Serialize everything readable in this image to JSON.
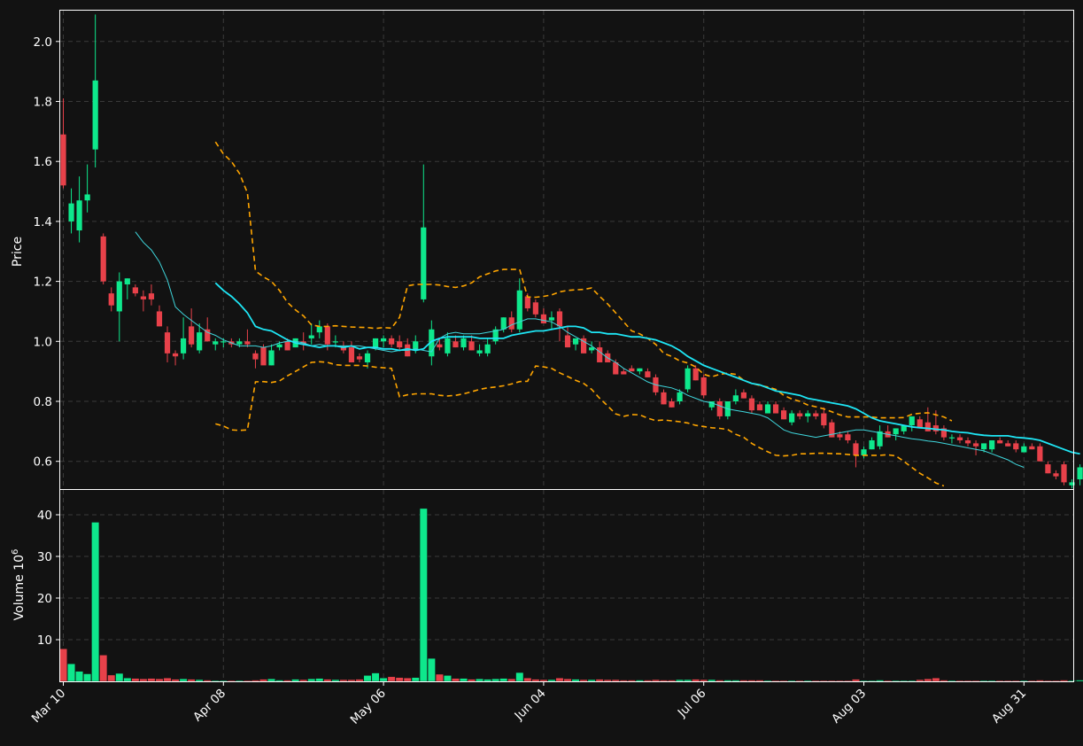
{
  "colors": {
    "background": "#121212",
    "up": "#0ee88c",
    "down": "#e8414a",
    "ma_fast": "#1ee6f5",
    "ma_slow": "#3fd6dc",
    "bands": "#ffa500",
    "grid": "#3a3a3a",
    "frame": "#ffffff"
  },
  "chart_data": {
    "type": "candlestick",
    "ylabel": "Price",
    "volume_label": "Volume  10",
    "volume_exponent": "6",
    "price_ticks": [
      "0.6",
      "0.8",
      "1.0",
      "1.2",
      "1.4",
      "1.6",
      "1.8",
      "2.0"
    ],
    "volume_ticks": [
      "10",
      "20",
      "30",
      "40"
    ],
    "x_tick_labels": [
      "Mar 10",
      "Apr 08",
      "May 06",
      "Jun 04",
      "Jul 06",
      "Aug 03",
      "Aug 31"
    ],
    "x_tick_index": [
      0,
      20,
      40,
      60,
      80,
      100,
      120
    ],
    "ylim": [
      0.5,
      2.1
    ],
    "volume_ylim": [
      0,
      46
    ],
    "grid": true,
    "candles": [
      [
        1.69,
        1.81,
        1.51,
        1.52,
        7.8
      ],
      [
        1.4,
        1.51,
        1.36,
        1.46,
        4.2
      ],
      [
        1.37,
        1.55,
        1.33,
        1.47,
        2.4
      ],
      [
        1.47,
        1.59,
        1.43,
        1.49,
        1.8
      ],
      [
        1.64,
        2.09,
        1.58,
        1.87,
        38.2
      ],
      [
        1.35,
        1.36,
        1.19,
        1.2,
        6.3
      ],
      [
        1.16,
        1.18,
        1.1,
        1.12,
        1.5
      ],
      [
        1.1,
        1.23,
        1,
        1.2,
        1.9
      ],
      [
        1.19,
        1.21,
        1.14,
        1.21,
        0.8
      ],
      [
        1.18,
        1.19,
        1.15,
        1.16,
        0.7
      ],
      [
        1.15,
        1.17,
        1.1,
        1.14,
        0.6
      ],
      [
        1.16,
        1.19,
        1.12,
        1.14,
        0.7
      ],
      [
        1.1,
        1.12,
        1.05,
        1.05,
        0.6
      ],
      [
        1.03,
        1.05,
        0.93,
        0.96,
        0.8
      ],
      [
        0.96,
        0.97,
        0.92,
        0.95,
        0.5
      ],
      [
        0.96,
        1.08,
        0.94,
        1.01,
        0.6
      ],
      [
        1.05,
        1.11,
        0.98,
        0.99,
        0.5
      ],
      [
        0.97,
        1.06,
        0.96,
        1.03,
        0.4
      ],
      [
        1.04,
        1.08,
        1,
        1,
        0.3
      ],
      [
        0.99,
        1.01,
        0.97,
        1,
        0.2
      ],
      [
        1,
        1.01,
        0.98,
        1,
        0.2
      ],
      [
        1,
        1.01,
        0.98,
        0.99,
        0.2
      ],
      [
        0.99,
        1.01,
        0.98,
        1,
        0.2
      ],
      [
        1,
        1.04,
        0.98,
        0.99,
        0.2
      ],
      [
        0.96,
        0.97,
        0.91,
        0.94,
        0.3
      ],
      [
        0.98,
        0.99,
        0.93,
        0.92,
        0.5
      ],
      [
        0.92,
        0.99,
        0.92,
        0.97,
        0.6
      ],
      [
        0.98,
        1,
        0.97,
        0.99,
        0.3
      ],
      [
        1,
        1.01,
        0.97,
        0.97,
        0.3
      ],
      [
        0.98,
        1.01,
        0.98,
        1.01,
        0.5
      ],
      [
        1,
        1.03,
        0.97,
        0.99,
        0.4
      ],
      [
        1.01,
        1.06,
        0.99,
        1.02,
        0.6
      ],
      [
        1.03,
        1.07,
        1.01,
        1.05,
        0.7
      ],
      [
        1.05,
        1.06,
        0.97,
        0.99,
        0.5
      ],
      [
        1,
        1.02,
        0.98,
        1,
        0.4
      ],
      [
        0.98,
        1,
        0.96,
        0.97,
        0.4
      ],
      [
        0.98,
        1,
        0.93,
        0.93,
        0.4
      ],
      [
        0.95,
        0.96,
        0.93,
        0.94,
        0.5
      ],
      [
        0.93,
        0.97,
        0.91,
        0.96,
        1.4
      ],
      [
        0.98,
        1.01,
        0.97,
        1.01,
        2
      ],
      [
        1,
        1.02,
        0.98,
        1.01,
        0.8
      ],
      [
        1.01,
        1.02,
        0.98,
        0.99,
        1.1
      ],
      [
        1,
        1.02,
        0.97,
        0.98,
        0.9
      ],
      [
        0.99,
        1.01,
        0.95,
        0.95,
        0.8
      ],
      [
        0.97,
        1.02,
        0.96,
        1,
        0.9
      ],
      [
        1.14,
        1.59,
        1.13,
        1.38,
        41.5
      ],
      [
        0.95,
        1.07,
        0.92,
        1.04,
        5.5
      ],
      [
        0.99,
        1.01,
        0.97,
        0.98,
        1.7
      ],
      [
        0.96,
        1.03,
        0.95,
        1.01,
        1.4
      ],
      [
        1,
        1.02,
        0.98,
        0.98,
        0.7
      ],
      [
        0.98,
        1.02,
        0.97,
        1.01,
        0.7
      ],
      [
        1,
        1.02,
        0.97,
        0.97,
        0.5
      ],
      [
        0.96,
        0.99,
        0.95,
        0.97,
        0.6
      ],
      [
        0.96,
        1.01,
        0.95,
        0.99,
        0.5
      ],
      [
        1,
        1.05,
        0.99,
        1.04,
        0.6
      ],
      [
        1.04,
        1.08,
        1.03,
        1.08,
        0.7
      ],
      [
        1.08,
        1.1,
        1.03,
        1.04,
        0.6
      ],
      [
        1.04,
        1.21,
        1.03,
        1.17,
        2.1
      ],
      [
        1.15,
        1.16,
        1.1,
        1.11,
        0.8
      ],
      [
        1.13,
        1.14,
        1.08,
        1.09,
        0.5
      ],
      [
        1.09,
        1.11,
        1.06,
        1.06,
        0.4
      ],
      [
        1.07,
        1.1,
        1.04,
        1.08,
        0.4
      ],
      [
        1.1,
        1.11,
        1,
        1.05,
        0.8
      ],
      [
        1.02,
        1.05,
        0.98,
        0.98,
        0.6
      ],
      [
        0.99,
        1.01,
        0.97,
        1.01,
        0.5
      ],
      [
        1.01,
        1.02,
        0.96,
        0.96,
        0.4
      ],
      [
        0.97,
        1,
        0.96,
        0.98,
        0.4
      ],
      [
        0.98,
        1,
        0.93,
        0.93,
        0.5
      ],
      [
        0.96,
        0.97,
        0.93,
        0.93,
        0.4
      ],
      [
        0.93,
        0.94,
        0.89,
        0.89,
        0.4
      ],
      [
        0.9,
        0.91,
        0.89,
        0.89,
        0.3
      ],
      [
        0.91,
        0.92,
        0.9,
        0.9,
        0.3
      ],
      [
        0.9,
        0.91,
        0.89,
        0.91,
        0.3
      ],
      [
        0.9,
        0.91,
        0.88,
        0.88,
        0.3
      ],
      [
        0.88,
        0.89,
        0.82,
        0.83,
        0.4
      ],
      [
        0.83,
        0.84,
        0.79,
        0.79,
        0.3
      ],
      [
        0.8,
        0.81,
        0.78,
        0.78,
        0.3
      ],
      [
        0.8,
        0.84,
        0.79,
        0.83,
        0.4
      ],
      [
        0.84,
        0.92,
        0.83,
        0.91,
        0.4
      ],
      [
        0.91,
        0.92,
        0.87,
        0.87,
        0.5
      ],
      [
        0.88,
        0.89,
        0.81,
        0.82,
        0.4
      ],
      [
        0.78,
        0.8,
        0.77,
        0.8,
        0.4
      ],
      [
        0.8,
        0.81,
        0.74,
        0.75,
        0.3
      ],
      [
        0.75,
        0.8,
        0.74,
        0.8,
        0.3
      ],
      [
        0.8,
        0.84,
        0.79,
        0.82,
        0.3
      ],
      [
        0.83,
        0.84,
        0.81,
        0.81,
        0.3
      ],
      [
        0.81,
        0.82,
        0.76,
        0.77,
        0.3
      ],
      [
        0.79,
        0.8,
        0.77,
        0.77,
        0.3
      ],
      [
        0.76,
        0.8,
        0.76,
        0.79,
        0.2
      ],
      [
        0.79,
        0.8,
        0.76,
        0.76,
        0.2
      ],
      [
        0.77,
        0.78,
        0.74,
        0.74,
        0.2
      ],
      [
        0.73,
        0.77,
        0.72,
        0.76,
        0.2
      ],
      [
        0.76,
        0.77,
        0.74,
        0.75,
        0.2
      ],
      [
        0.75,
        0.77,
        0.73,
        0.76,
        0.2
      ],
      [
        0.76,
        0.77,
        0.74,
        0.75,
        0.2
      ],
      [
        0.76,
        0.78,
        0.71,
        0.72,
        0.2
      ],
      [
        0.73,
        0.74,
        0.68,
        0.68,
        0.2
      ],
      [
        0.69,
        0.7,
        0.67,
        0.68,
        0.2
      ],
      [
        0.69,
        0.7,
        0.66,
        0.67,
        0.2
      ],
      [
        0.66,
        0.67,
        0.58,
        0.62,
        0.5
      ],
      [
        0.62,
        0.65,
        0.61,
        0.64,
        0.2
      ],
      [
        0.64,
        0.68,
        0.64,
        0.67,
        0.2
      ],
      [
        0.65,
        0.72,
        0.64,
        0.7,
        0.3
      ],
      [
        0.7,
        0.72,
        0.68,
        0.68,
        0.2
      ],
      [
        0.69,
        0.71,
        0.67,
        0.71,
        0.2
      ],
      [
        0.7,
        0.72,
        0.69,
        0.72,
        0.2
      ],
      [
        0.72,
        0.75,
        0.7,
        0.75,
        0.2
      ],
      [
        0.74,
        0.75,
        0.71,
        0.71,
        0.4
      ],
      [
        0.73,
        0.78,
        0.7,
        0.7,
        0.6
      ],
      [
        0.72,
        0.77,
        0.69,
        0.7,
        0.8
      ],
      [
        0.71,
        0.72,
        0.67,
        0.68,
        0.3
      ],
      [
        0.68,
        0.69,
        0.66,
        0.68,
        0.2
      ],
      [
        0.68,
        0.69,
        0.66,
        0.67,
        0.2
      ],
      [
        0.67,
        0.68,
        0.65,
        0.66,
        0.2
      ],
      [
        0.66,
        0.67,
        0.62,
        0.65,
        0.2
      ],
      [
        0.64,
        0.66,
        0.63,
        0.66,
        0.2
      ],
      [
        0.64,
        0.67,
        0.63,
        0.67,
        0.2
      ],
      [
        0.67,
        0.68,
        0.66,
        0.66,
        0.2
      ],
      [
        0.66,
        0.67,
        0.65,
        0.65,
        0.2
      ],
      [
        0.66,
        0.67,
        0.63,
        0.64,
        0.2
      ],
      [
        0.63,
        0.66,
        0.63,
        0.65,
        0.2
      ],
      [
        0.65,
        0.66,
        0.64,
        0.64,
        0.2
      ],
      [
        0.65,
        0.66,
        0.6,
        0.6,
        0.3
      ],
      [
        0.59,
        0.6,
        0.56,
        0.56,
        0.2
      ],
      [
        0.56,
        0.57,
        0.54,
        0.55,
        0.2
      ],
      [
        0.59,
        0.6,
        0.52,
        0.53,
        0.3
      ],
      [
        0.52,
        0.54,
        0.51,
        0.53,
        0.2
      ],
      [
        0.54,
        0.59,
        0.52,
        0.58,
        0.3
      ],
      [
        0.58,
        0.58,
        0.55,
        0.55,
        0.2
      ]
    ],
    "ma_fast_start": 19,
    "ma_fast": [
      1.195,
      1.17,
      1.15,
      1.125,
      1.095,
      1.05,
      1.04,
      1.035,
      1.02,
      1.005,
      0.995,
      0.99,
      0.985,
      0.98,
      0.985,
      0.985,
      0.98,
      0.985,
      0.975,
      0.98,
      0.98,
      0.975,
      0.975,
      0.97,
      0.975,
      0.97,
      0.975,
      1.0,
      1.01,
      1.015,
      1.015,
      1.015,
      1.015,
      1.01,
      1.01,
      1.01,
      1.01,
      1.02,
      1.025,
      1.03,
      1.035,
      1.035,
      1.04,
      1.045,
      1.05,
      1.05,
      1.045,
      1.03,
      1.03,
      1.025,
      1.025,
      1.02,
      1.015,
      1.015,
      1.01,
      1.005,
      0.995,
      0.985,
      0.97,
      0.95,
      0.935,
      0.92,
      0.91,
      0.9,
      0.89,
      0.88,
      0.87,
      0.86,
      0.855,
      0.845,
      0.835,
      0.83,
      0.825,
      0.82,
      0.81,
      0.805,
      0.8,
      0.795,
      0.79,
      0.785,
      0.775,
      0.76,
      0.745,
      0.735,
      0.73,
      0.725,
      0.72,
      0.715,
      0.712,
      0.71,
      0.707,
      0.705,
      0.7,
      0.697,
      0.695,
      0.69,
      0.687,
      0.685,
      0.685,
      0.685,
      0.68,
      0.678,
      0.675,
      0.67,
      0.66,
      0.65,
      0.64,
      0.63,
      0.625
    ],
    "ma_slow_start": 9,
    "ma_slow": [
      1.365,
      1.33,
      1.305,
      1.265,
      1.205,
      1.115,
      1.09,
      1.07,
      1.05,
      1.03,
      1.02,
      1.005,
      0.995,
      0.985,
      0.985,
      0.985,
      0.98,
      0.985,
      0.995,
      1.0,
      1.0,
      0.995,
      0.985,
      0.99,
      0.985,
      0.985,
      0.985,
      0.985,
      0.985,
      0.98,
      0.975,
      0.97,
      0.965,
      0.97,
      0.97,
      0.975,
      0.97,
      0.965,
      1.01,
      1.025,
      1.03,
      1.025,
      1.025,
      1.025,
      1.03,
      1.035,
      1.04,
      1.055,
      1.065,
      1.075,
      1.075,
      1.07,
      1.065,
      1.05,
      1.03,
      1.015,
      1.0,
      0.985,
      0.965,
      0.945,
      0.93,
      0.91,
      0.895,
      0.88,
      0.865,
      0.855,
      0.85,
      0.845,
      0.835,
      0.82,
      0.81,
      0.8,
      0.795,
      0.785,
      0.775,
      0.77,
      0.765,
      0.76,
      0.755,
      0.745,
      0.725,
      0.705,
      0.695,
      0.69,
      0.685,
      0.68,
      0.685,
      0.69,
      0.695,
      0.7,
      0.705,
      0.705,
      0.7,
      0.695,
      0.69,
      0.685,
      0.68,
      0.675,
      0.672,
      0.668,
      0.665,
      0.66,
      0.655,
      0.65,
      0.645,
      0.64,
      0.635,
      0.625,
      0.615,
      0.605,
      0.59,
      0.58
    ],
    "bands_start": 19,
    "upper_band": [
      1.665,
      1.625,
      1.6,
      1.56,
      1.495,
      1.235,
      1.215,
      1.2,
      1.17,
      1.13,
      1.105,
      1.085,
      1.055,
      1.05,
      1.05,
      1.052,
      1.05,
      1.048,
      1.047,
      1.046,
      1.043,
      1.046,
      1.044,
      1.08,
      1.185,
      1.19,
      1.19,
      1.19,
      1.188,
      1.183,
      1.18,
      1.185,
      1.195,
      1.215,
      1.225,
      1.235,
      1.24,
      1.24,
      1.24,
      1.148,
      1.147,
      1.15,
      1.155,
      1.165,
      1.17,
      1.172,
      1.173,
      1.178,
      1.15,
      1.125,
      1.095,
      1.065,
      1.035,
      1.025,
      1.01,
      0.99,
      0.96,
      0.95,
      0.935,
      0.928,
      0.915,
      0.89,
      0.882,
      0.89,
      0.894,
      0.89,
      0.87,
      0.86,
      0.853,
      0.848,
      0.84,
      0.82,
      0.808,
      0.8,
      0.788,
      0.782,
      0.775,
      0.765,
      0.755,
      0.748,
      0.748,
      0.748,
      0.748,
      0.745,
      0.745,
      0.745,
      0.746,
      0.757,
      0.76,
      0.762,
      0.755,
      0.748,
      0.735
    ],
    "lower_band": [
      0.725,
      0.718,
      0.705,
      0.703,
      0.705,
      0.865,
      0.866,
      0.863,
      0.868,
      0.885,
      0.9,
      0.915,
      0.93,
      0.932,
      0.93,
      0.922,
      0.92,
      0.92,
      0.92,
      0.918,
      0.914,
      0.912,
      0.91,
      0.815,
      0.822,
      0.825,
      0.825,
      0.825,
      0.82,
      0.818,
      0.82,
      0.825,
      0.832,
      0.84,
      0.845,
      0.848,
      0.852,
      0.858,
      0.866,
      0.867,
      0.918,
      0.915,
      0.91,
      0.895,
      0.883,
      0.87,
      0.86,
      0.84,
      0.81,
      0.785,
      0.758,
      0.75,
      0.756,
      0.755,
      0.744,
      0.736,
      0.738,
      0.735,
      0.732,
      0.728,
      0.72,
      0.716,
      0.712,
      0.71,
      0.706,
      0.69,
      0.68,
      0.66,
      0.645,
      0.632,
      0.62,
      0.618,
      0.62,
      0.625,
      0.625,
      0.627,
      0.627,
      0.626,
      0.625,
      0.623,
      0.62,
      0.62,
      0.62,
      0.62,
      0.622,
      0.618,
      0.6,
      0.58,
      0.56,
      0.545,
      0.528,
      0.518
    ]
  }
}
